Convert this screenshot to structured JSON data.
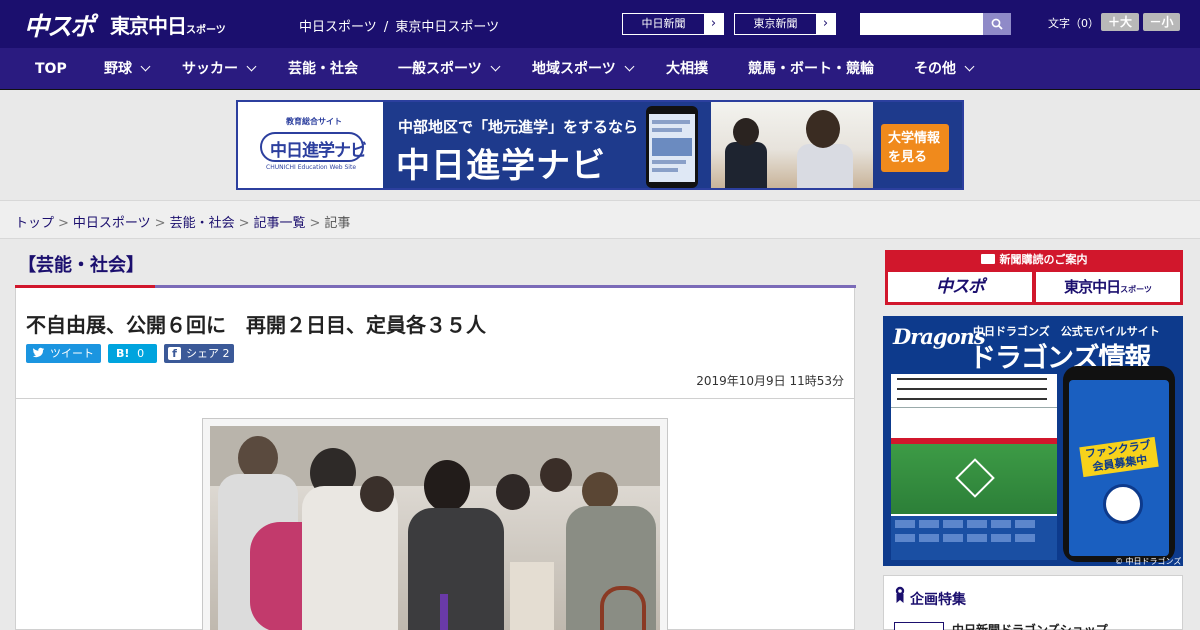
{
  "header": {
    "logo_chuspo": "中スポ",
    "logo_tokyo": "東京中日",
    "logo_tokyo_small": "スポーツ",
    "site_link_1": "中日スポーツ",
    "site_link_sep": "/",
    "site_link_2": "東京中日スポーツ",
    "paper_1": "中日新聞",
    "paper_2": "東京新聞",
    "search_value": "",
    "font_size_label": "文字（0）",
    "font_bigger": "＋大",
    "font_smaller": "－小"
  },
  "nav": {
    "items": [
      {
        "label": "TOP",
        "has_menu": false
      },
      {
        "label": "野球",
        "has_menu": true
      },
      {
        "label": "サッカー",
        "has_menu": true
      },
      {
        "label": "芸能・社会",
        "has_menu": false
      },
      {
        "label": "一般スポーツ",
        "has_menu": true
      },
      {
        "label": "地域スポーツ",
        "has_menu": true
      },
      {
        "label": "大相撲",
        "has_menu": false
      },
      {
        "label": "競馬・ボート・競輪",
        "has_menu": false
      },
      {
        "label": "その他",
        "has_menu": true
      }
    ]
  },
  "banner": {
    "logo_sub": "教育総合サイト",
    "logo_main": "中日進学ナビ",
    "logo_en": "CHUNICHI Education Web Site",
    "copy_line1": "中部地区で「地元進学」をするなら",
    "copy_line2": "中日進学ナビ",
    "cta_line1": "大学情報",
    "cta_line2": "を見る"
  },
  "breadcrumb": {
    "items": [
      "トップ",
      "中日スポーツ",
      "芸能・社会",
      "記事一覧"
    ],
    "current": "記事",
    "separator": ">"
  },
  "article": {
    "category": "【芸能・社会】",
    "title": "不自由展、公開６回に　再開２日目、定員各３５人",
    "share_tweet": "ツイート",
    "share_hatena_label": "B!",
    "share_hatena_count": "0",
    "share_fb_label": "シェア",
    "share_fb_count": "2",
    "date": "2019年10月9日 11時53分"
  },
  "sidebar": {
    "subscribe_head": "新聞購読のご案内",
    "subscribe_chuspo": "中スポ",
    "subscribe_tokyo": "東京中日",
    "subscribe_tokyo_small": "スポーツ",
    "dragons_logo": "Dragons",
    "dragons_sub": "中日ドラゴンズ　公式モバイルサイト",
    "dragons_main": "ドラゴンズ情報",
    "dragons_fanclub": "ファンクラブ 会員募集中",
    "dragons_footer": "© 中日ドラゴンズ",
    "special_title": "企画特集",
    "special_item": "中日新聞ドラゴンズショップ"
  },
  "colors": {
    "header_bg": "#1b0f6e",
    "nav_bg": "#2a1b80",
    "accent_red": "#d1172c",
    "accent_purple": "#7b6bb8",
    "twitter": "#1b95e0",
    "hatena": "#00a4de",
    "facebook": "#3b5998"
  }
}
